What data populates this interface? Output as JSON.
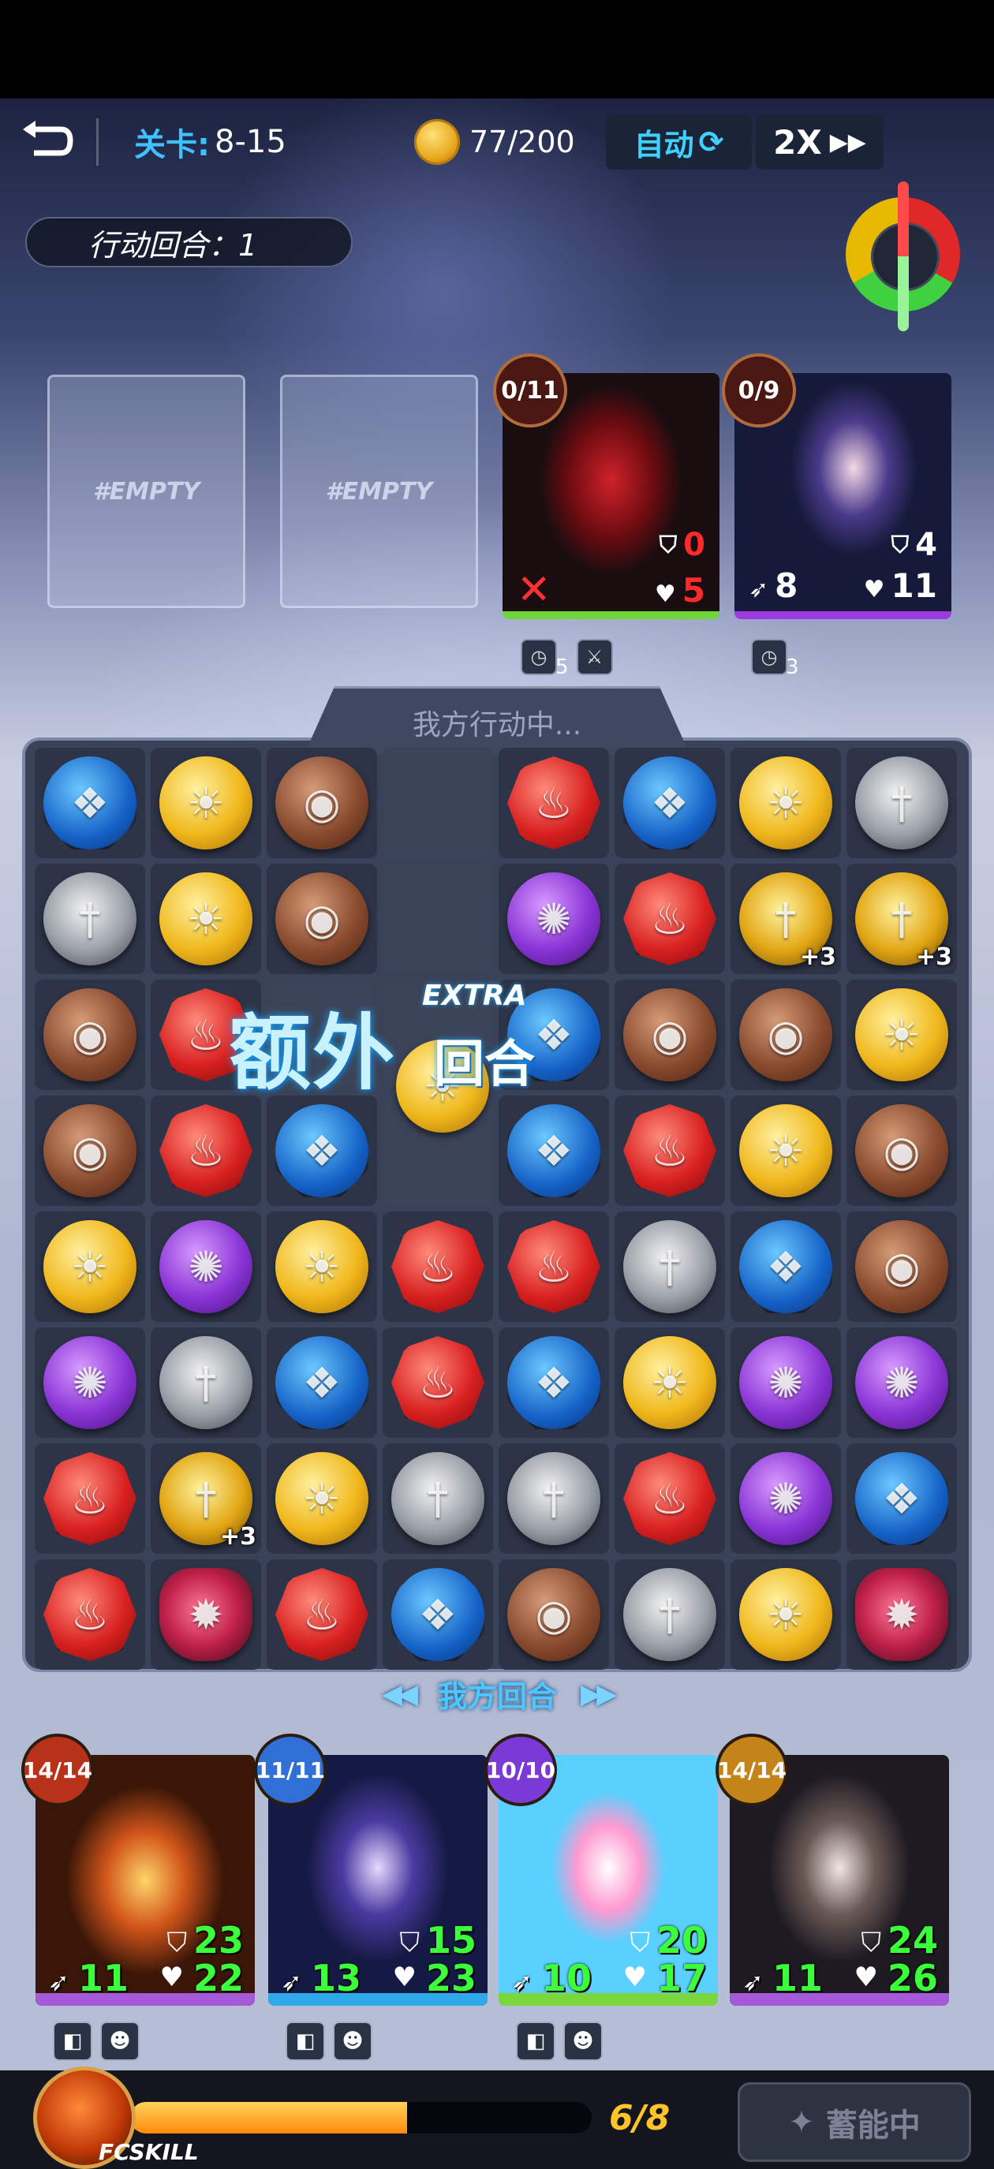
{
  "header": {
    "stage_label": "关卡:",
    "stage_value": "8-15",
    "coins": "77/200",
    "auto_label": "自动",
    "speed_label": "2X"
  },
  "turn_pill": "行动回合：1",
  "enemy_slots": [
    "#EMPTY",
    "#EMPTY"
  ],
  "enemies": [
    {
      "count": "0/11",
      "atk": "0",
      "hp": "5",
      "speed_blocked": true,
      "status_value": "5"
    },
    {
      "count": "0/9",
      "atk": "8",
      "def": "4",
      "hp": "11",
      "status_value": "3"
    }
  ],
  "board": {
    "status_text": "我方行动中...",
    "bottom_label": "我方回合",
    "grid": [
      [
        "blue",
        "yellow",
        "brown",
        "empty",
        "red",
        "blue",
        "yellow",
        "sword"
      ],
      [
        "sword",
        "yellow",
        "brown",
        "empty",
        "purple",
        "red",
        "gsword+3",
        "gsword+3"
      ],
      [
        "brown",
        "red",
        "empty",
        "empty",
        "blue",
        "brown",
        "brown",
        "yellow"
      ],
      [
        "brown",
        "red",
        "blue",
        "empty",
        "blue",
        "red",
        "yellow",
        "brown"
      ],
      [
        "yellow",
        "purple",
        "yellow",
        "red",
        "red",
        "sword",
        "blue",
        "brown"
      ],
      [
        "purple",
        "sword",
        "blue",
        "red",
        "blue",
        "yellow",
        "purple",
        "purple"
      ],
      [
        "red",
        "gsword+3",
        "yellow",
        "sword",
        "sword",
        "red",
        "purple",
        "blue"
      ],
      [
        "red",
        "beast",
        "red",
        "blue",
        "brown",
        "sword",
        "yellow",
        "beast"
      ]
    ],
    "extra_turn_cn_1": "额外",
    "extra_turn_cn_2": "回合",
    "extra_turn_en": "EXTRA"
  },
  "heroes": [
    {
      "hp_total": "14/14",
      "def": "23",
      "atk": "11",
      "hp": "22",
      "bar_color": "#a45ad8"
    },
    {
      "hp_total": "11/11",
      "def": "15",
      "atk": "13",
      "hp": "23",
      "bar_color": "#2fa9e8"
    },
    {
      "hp_total": "10/10",
      "def": "20",
      "atk": "10",
      "hp": "17",
      "bar_color": "#7ad63a"
    },
    {
      "hp_total": "14/14",
      "def": "24",
      "atk": "11",
      "hp": "26",
      "bar_color": "#a45ad8"
    }
  ],
  "footer": {
    "skill_label": "FCSKILL",
    "energy": "6/8",
    "energy_fraction": 0.6,
    "charge_label": "蓄能中"
  },
  "colors": {
    "accent_blue": "#3fc0ff",
    "green_stat": "#3aff3a",
    "energy_orange": "#ff8a0a"
  }
}
